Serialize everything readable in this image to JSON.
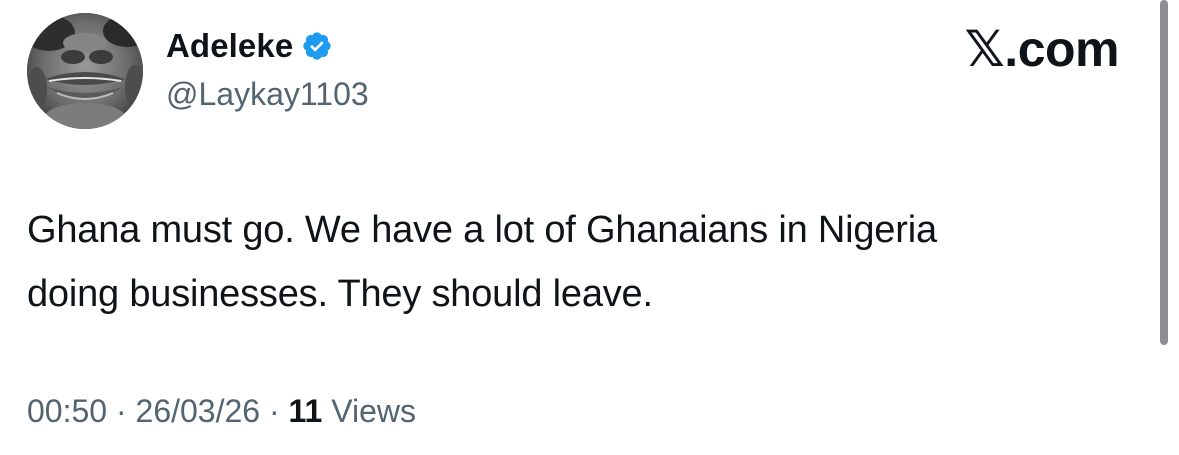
{
  "author": {
    "display_name": "Adeleke",
    "handle": "@Laykay1103",
    "verified": true
  },
  "brand": "𝕏.com",
  "tweet": {
    "line1": "Ghana must go. We have a lot of Ghanaians in Nigeria",
    "line2": "doing businesses. They should leave."
  },
  "meta": {
    "time": "00:50",
    "separator": " · ",
    "date": "26/03/26",
    "views_count": "11",
    "views_label": " Views"
  },
  "colors": {
    "text_primary": "#0f1419",
    "text_secondary": "#536471",
    "verified_blue": "#1d9bf0",
    "background": "#ffffff"
  },
  "icons": {
    "verified": "verified-badge-icon",
    "avatar": "profile-avatar"
  }
}
